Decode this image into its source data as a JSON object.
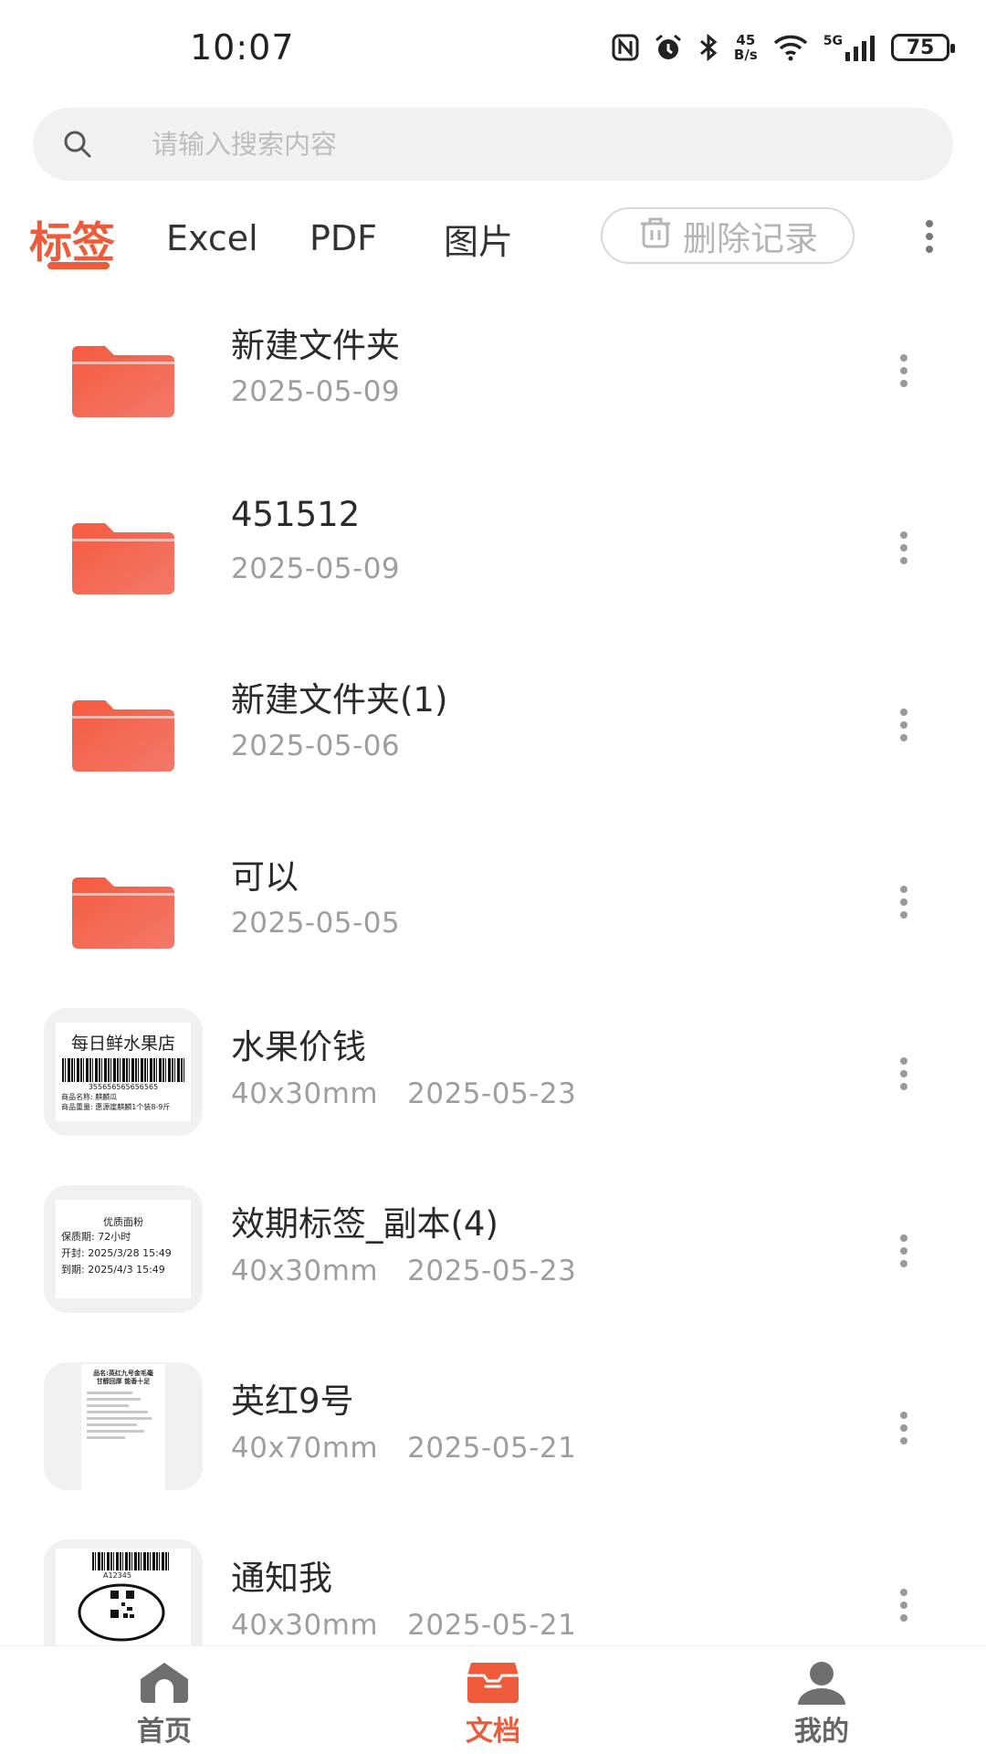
{
  "status_bar": {
    "time": "10:07",
    "net_speed_value": "45",
    "net_speed_unit": "B/s",
    "network": "5G",
    "battery": "75"
  },
  "search": {
    "placeholder": "请输入搜索内容",
    "value": ""
  },
  "tabs": {
    "items": [
      {
        "label": "标签",
        "active": true
      },
      {
        "label": "Excel",
        "active": false
      },
      {
        "label": "PDF",
        "active": false
      },
      {
        "label": "图片",
        "active": false
      }
    ],
    "delete_label": "删除记录"
  },
  "files": [
    {
      "type": "folder",
      "name": "新建文件夹",
      "date": "2025-05-09"
    },
    {
      "type": "folder",
      "name": "451512",
      "date": "2025-05-09"
    },
    {
      "type": "folder",
      "name": "新建文件夹(1)",
      "date": "2025-05-06"
    },
    {
      "type": "folder",
      "name": "可以",
      "date": "2025-05-05"
    },
    {
      "type": "label",
      "name": "水果价钱",
      "size": "40x30mm",
      "date": "2025-05-23"
    },
    {
      "type": "label",
      "name": "效期标签_副本(4)",
      "size": "40x30mm",
      "date": "2025-05-23"
    },
    {
      "type": "label",
      "name": "英红9号",
      "size": "40x70mm",
      "date": "2025-05-21"
    },
    {
      "type": "label",
      "name": "通知我",
      "size": "40x30mm",
      "date": "2025-05-21"
    }
  ],
  "previews": {
    "fruit": {
      "title": "每日鲜水果店",
      "code": "355656565656565",
      "line1": "商品名称: 麒麟瓜",
      "line2": "商品重量: 惠源崖麒麟1个装8-9斤"
    },
    "expiry": {
      "title": "优质面粉",
      "line1": "保质期:  72小时",
      "line2": "开封:  2025/3/28  15:49",
      "line3": "到期:  2025/4/3   15:49"
    },
    "tea": {
      "line1": "品名:英红九号金毛毫",
      "line2": "甘醇回厚 能香十足"
    },
    "notice": {
      "code": "A12345"
    }
  },
  "bottom_nav": [
    {
      "label": "首页",
      "icon": "home-icon",
      "active": false
    },
    {
      "label": "文档",
      "icon": "document-box-icon",
      "active": true
    },
    {
      "label": "我的",
      "icon": "user-icon",
      "active": false
    }
  ],
  "colors": {
    "accent": "#ef5a3a",
    "folder": "#f26a4f"
  }
}
